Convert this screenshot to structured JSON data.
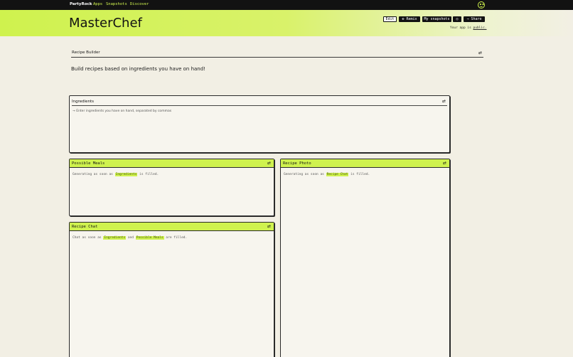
{
  "topnav": {
    "brand": "PartyRock",
    "links": [
      "Apps",
      "Snapshots",
      "Discover"
    ]
  },
  "header": {
    "title": "MasterChef",
    "buttons": {
      "edit": "Edit",
      "remix": "⊕ Remix",
      "snapshots": "My snapshots",
      "settings": "◎",
      "share": "→ Share"
    },
    "public_prefix": "Your app is",
    "public_link": "public."
  },
  "builder": {
    "label": "Recipe Builder",
    "description": "Build recipes based on ingredients you have on hand!"
  },
  "widgets": {
    "ingredients": {
      "title": "Ingredients",
      "placeholder": "Enter ingredients you have on hand, separated by commas"
    },
    "possible_meals": {
      "title": "Possible Meals",
      "pre": "Generating as soon as",
      "ref1": "Ingredients",
      "post": "is filled."
    },
    "recipe_photo": {
      "title": "Recipe Photo",
      "pre": "Generating as soon as",
      "ref1": "Recipe Chat",
      "post": "is filled."
    },
    "recipe_chat": {
      "title": "Recipe Chat",
      "pre": "Chat as soon as",
      "ref1": "Ingredients",
      "mid": "and",
      "ref2": "Possible Meals",
      "post": "are filled."
    }
  },
  "icons": {
    "swap": "⇄",
    "arrow": "→"
  },
  "colors": {
    "accent": "#cff24e",
    "nav": "#121212",
    "background": "#f2efe4"
  }
}
